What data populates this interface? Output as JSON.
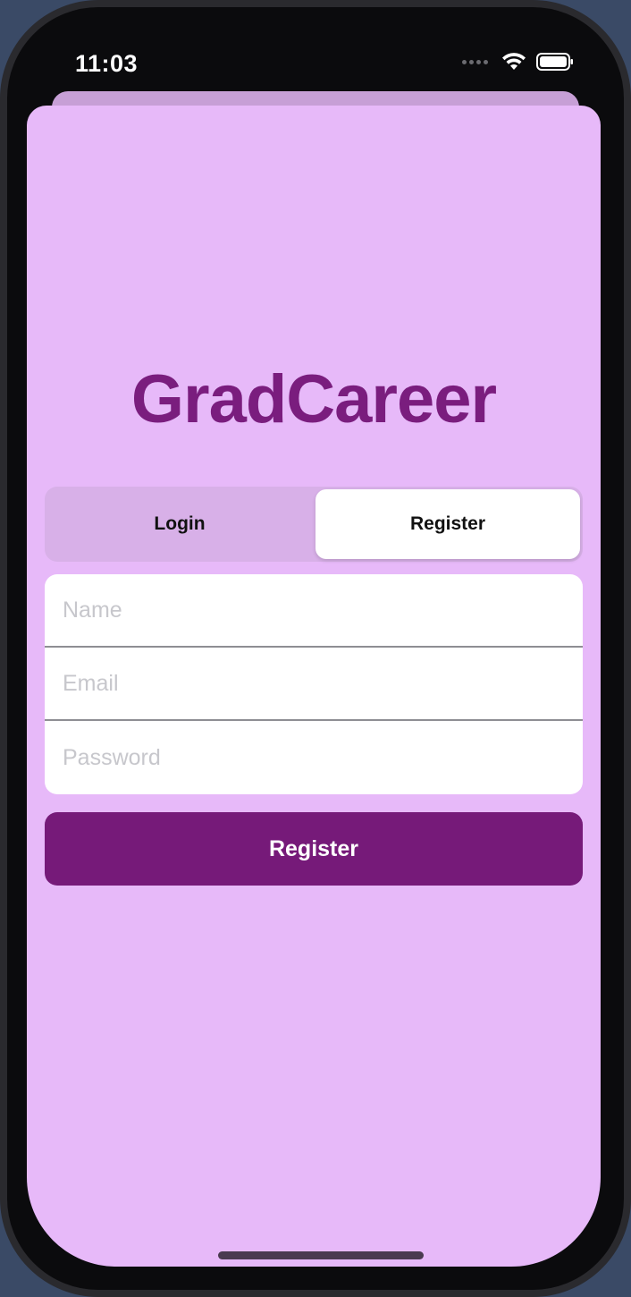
{
  "status_bar": {
    "time": "11:03"
  },
  "app": {
    "title": "GradCareer"
  },
  "segmented_control": {
    "options": [
      {
        "label": "Login",
        "selected": false
      },
      {
        "label": "Register",
        "selected": true
      }
    ]
  },
  "form": {
    "name_placeholder": "Name",
    "email_placeholder": "Email",
    "password_placeholder": "Password",
    "name_value": "",
    "email_value": "",
    "password_value": ""
  },
  "actions": {
    "submit_label": "Register"
  },
  "colors": {
    "accent": "#761a79",
    "title": "#7a1d7e",
    "sheet_background": "#e7b9f9",
    "segment_background": "#d8b0e8"
  },
  "icons": {
    "wifi": "wifi-icon",
    "battery": "battery-icon",
    "signal": "cellular-signal-icon"
  }
}
